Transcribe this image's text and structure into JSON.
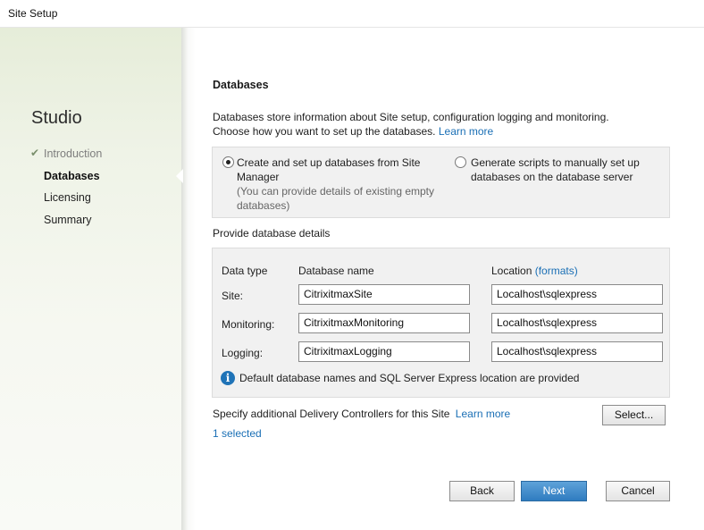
{
  "window": {
    "title": "Site Setup"
  },
  "sidebar": {
    "app_name": "Studio",
    "steps": [
      {
        "label": "Introduction",
        "state": "done"
      },
      {
        "label": "Databases",
        "state": "active"
      },
      {
        "label": "Licensing",
        "state": "pending"
      },
      {
        "label": "Summary",
        "state": "pending"
      }
    ]
  },
  "main": {
    "heading": "Databases",
    "intro_line1": "Databases store information about Site setup, configuration logging and monitoring.",
    "intro_line2": "Choose how you want to set up the databases.",
    "learn_more": "Learn more",
    "options": {
      "create": {
        "line1": "Create and set up databases from Site",
        "line2": "Manager",
        "note1": "(You can provide details of existing empty",
        "note2": "databases)",
        "selected": true
      },
      "scripts": {
        "line1": "Generate scripts to manually set up",
        "line2": "databases on the database server",
        "selected": false
      }
    },
    "details_label": "Provide database details",
    "table": {
      "col_type": "Data type",
      "col_name": "Database name",
      "col_location": "Location",
      "formats_link": "(formats)",
      "rows": [
        {
          "type": "Site:",
          "name": "CitrixitmaxSite",
          "location": "Localhost\\sqlexpress"
        },
        {
          "type": "Monitoring:",
          "name": "CitrixitmaxMonitoring",
          "location": "Localhost\\sqlexpress"
        },
        {
          "type": "Logging:",
          "name": "CitrixitmaxLogging",
          "location": "Localhost\\sqlexpress"
        }
      ],
      "info": "Default database names and SQL Server Express location are provided"
    },
    "controllers_label": "Specify additional Delivery Controllers for this Site",
    "controllers_learn_more": "Learn more",
    "select_button": "Select...",
    "selected_count": "1 selected"
  },
  "footer": {
    "back": "Back",
    "next": "Next",
    "cancel": "Cancel"
  },
  "colors": {
    "link": "#1a6fb5",
    "primary": "#2f7cc0",
    "sidebar_bg": "#eff3e7"
  },
  "icons": {
    "check": "check-icon",
    "info": "info-icon"
  }
}
